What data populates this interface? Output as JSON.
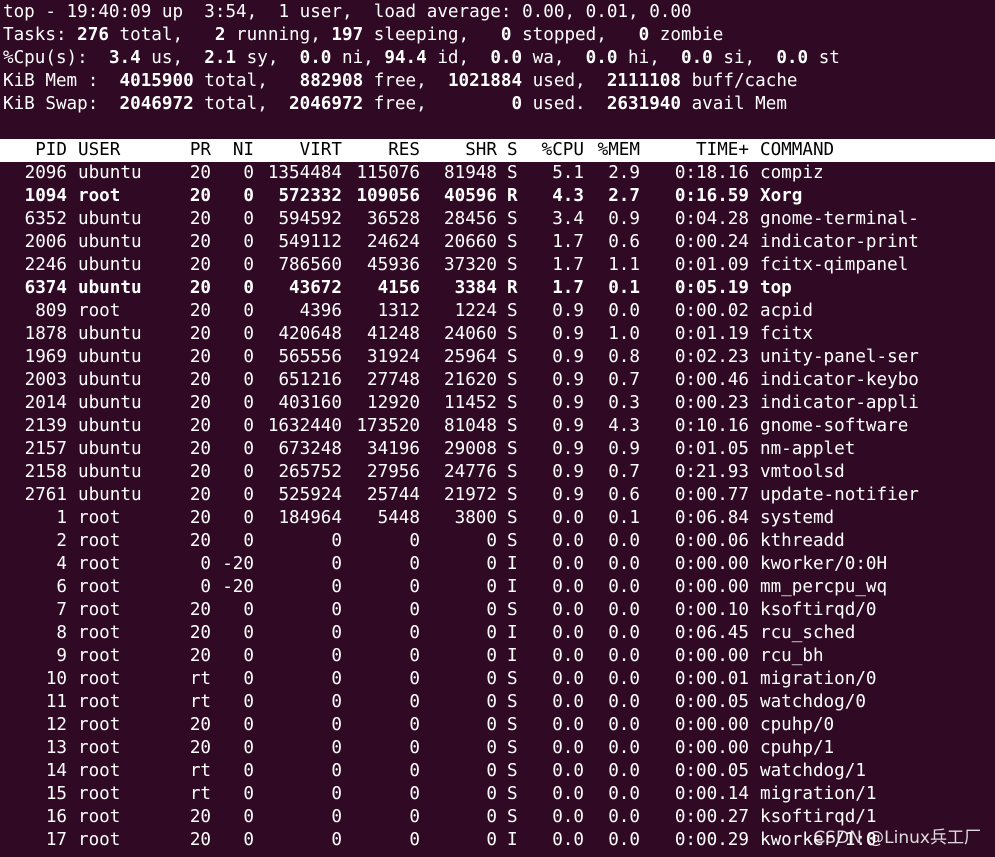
{
  "summary": {
    "uptime": {
      "time": "19:40:09",
      "up": "3:54",
      "users": "1",
      "load_avg": [
        "0.00",
        "0.01",
        "0.00"
      ]
    },
    "tasks": {
      "total": "276",
      "running": "2",
      "sleeping": "197",
      "stopped": "0",
      "zombie": "0"
    },
    "cpu": {
      "us": "3.4",
      "sy": "2.1",
      "ni": "0.0",
      "id": "94.4",
      "wa": "0.0",
      "hi": "0.0",
      "si": "0.0",
      "st": "0.0"
    },
    "mem": {
      "total": "4015900",
      "free": "882908",
      "used": "1021884",
      "buff_cache": "2111108"
    },
    "swap": {
      "total": "2046972",
      "free": "2046972",
      "used": "0",
      "avail_mem": "2631940"
    }
  },
  "columns": [
    "PID",
    "USER",
    "PR",
    "NI",
    "VIRT",
    "RES",
    "SHR",
    "S",
    "%CPU",
    "%MEM",
    "TIME+",
    "COMMAND"
  ],
  "processes": [
    {
      "pid": "2096",
      "user": "ubuntu",
      "pr": "20",
      "ni": "0",
      "virt": "1354484",
      "res": "115076",
      "shr": "81948",
      "s": "S",
      "cpu": "5.1",
      "mem": "2.9",
      "time": "0:18.16",
      "command": "compiz",
      "bold": false
    },
    {
      "pid": "1094",
      "user": "root",
      "pr": "20",
      "ni": "0",
      "virt": "572332",
      "res": "109056",
      "shr": "40596",
      "s": "R",
      "cpu": "4.3",
      "mem": "2.7",
      "time": "0:16.59",
      "command": "Xorg",
      "bold": true
    },
    {
      "pid": "6352",
      "user": "ubuntu",
      "pr": "20",
      "ni": "0",
      "virt": "594592",
      "res": "36528",
      "shr": "28456",
      "s": "S",
      "cpu": "3.4",
      "mem": "0.9",
      "time": "0:04.28",
      "command": "gnome-terminal-",
      "bold": false
    },
    {
      "pid": "2006",
      "user": "ubuntu",
      "pr": "20",
      "ni": "0",
      "virt": "549112",
      "res": "24624",
      "shr": "20660",
      "s": "S",
      "cpu": "1.7",
      "mem": "0.6",
      "time": "0:00.24",
      "command": "indicator-print",
      "bold": false
    },
    {
      "pid": "2246",
      "user": "ubuntu",
      "pr": "20",
      "ni": "0",
      "virt": "786560",
      "res": "45936",
      "shr": "37320",
      "s": "S",
      "cpu": "1.7",
      "mem": "1.1",
      "time": "0:01.09",
      "command": "fcitx-qimpanel",
      "bold": false
    },
    {
      "pid": "6374",
      "user": "ubuntu",
      "pr": "20",
      "ni": "0",
      "virt": "43672",
      "res": "4156",
      "shr": "3384",
      "s": "R",
      "cpu": "1.7",
      "mem": "0.1",
      "time": "0:05.19",
      "command": "top",
      "bold": true
    },
    {
      "pid": "809",
      "user": "root",
      "pr": "20",
      "ni": "0",
      "virt": "4396",
      "res": "1312",
      "shr": "1224",
      "s": "S",
      "cpu": "0.9",
      "mem": "0.0",
      "time": "0:00.02",
      "command": "acpid",
      "bold": false
    },
    {
      "pid": "1878",
      "user": "ubuntu",
      "pr": "20",
      "ni": "0",
      "virt": "420648",
      "res": "41248",
      "shr": "24060",
      "s": "S",
      "cpu": "0.9",
      "mem": "1.0",
      "time": "0:01.19",
      "command": "fcitx",
      "bold": false
    },
    {
      "pid": "1969",
      "user": "ubuntu",
      "pr": "20",
      "ni": "0",
      "virt": "565556",
      "res": "31924",
      "shr": "25964",
      "s": "S",
      "cpu": "0.9",
      "mem": "0.8",
      "time": "0:02.23",
      "command": "unity-panel-ser",
      "bold": false
    },
    {
      "pid": "2003",
      "user": "ubuntu",
      "pr": "20",
      "ni": "0",
      "virt": "651216",
      "res": "27748",
      "shr": "21620",
      "s": "S",
      "cpu": "0.9",
      "mem": "0.7",
      "time": "0:00.46",
      "command": "indicator-keybo",
      "bold": false
    },
    {
      "pid": "2014",
      "user": "ubuntu",
      "pr": "20",
      "ni": "0",
      "virt": "403160",
      "res": "12920",
      "shr": "11452",
      "s": "S",
      "cpu": "0.9",
      "mem": "0.3",
      "time": "0:00.23",
      "command": "indicator-appli",
      "bold": false
    },
    {
      "pid": "2139",
      "user": "ubuntu",
      "pr": "20",
      "ni": "0",
      "virt": "1632440",
      "res": "173520",
      "shr": "81048",
      "s": "S",
      "cpu": "0.9",
      "mem": "4.3",
      "time": "0:10.16",
      "command": "gnome-software",
      "bold": false
    },
    {
      "pid": "2157",
      "user": "ubuntu",
      "pr": "20",
      "ni": "0",
      "virt": "673248",
      "res": "34196",
      "shr": "29008",
      "s": "S",
      "cpu": "0.9",
      "mem": "0.9",
      "time": "0:01.05",
      "command": "nm-applet",
      "bold": false
    },
    {
      "pid": "2158",
      "user": "ubuntu",
      "pr": "20",
      "ni": "0",
      "virt": "265752",
      "res": "27956",
      "shr": "24776",
      "s": "S",
      "cpu": "0.9",
      "mem": "0.7",
      "time": "0:21.93",
      "command": "vmtoolsd",
      "bold": false
    },
    {
      "pid": "2761",
      "user": "ubuntu",
      "pr": "20",
      "ni": "0",
      "virt": "525924",
      "res": "25744",
      "shr": "21972",
      "s": "S",
      "cpu": "0.9",
      "mem": "0.6",
      "time": "0:00.77",
      "command": "update-notifier",
      "bold": false
    },
    {
      "pid": "1",
      "user": "root",
      "pr": "20",
      "ni": "0",
      "virt": "184964",
      "res": "5448",
      "shr": "3800",
      "s": "S",
      "cpu": "0.0",
      "mem": "0.1",
      "time": "0:06.84",
      "command": "systemd",
      "bold": false
    },
    {
      "pid": "2",
      "user": "root",
      "pr": "20",
      "ni": "0",
      "virt": "0",
      "res": "0",
      "shr": "0",
      "s": "S",
      "cpu": "0.0",
      "mem": "0.0",
      "time": "0:00.06",
      "command": "kthreadd",
      "bold": false
    },
    {
      "pid": "4",
      "user": "root",
      "pr": "0",
      "ni": "-20",
      "virt": "0",
      "res": "0",
      "shr": "0",
      "s": "I",
      "cpu": "0.0",
      "mem": "0.0",
      "time": "0:00.00",
      "command": "kworker/0:0H",
      "bold": false
    },
    {
      "pid": "6",
      "user": "root",
      "pr": "0",
      "ni": "-20",
      "virt": "0",
      "res": "0",
      "shr": "0",
      "s": "I",
      "cpu": "0.0",
      "mem": "0.0",
      "time": "0:00.00",
      "command": "mm_percpu_wq",
      "bold": false
    },
    {
      "pid": "7",
      "user": "root",
      "pr": "20",
      "ni": "0",
      "virt": "0",
      "res": "0",
      "shr": "0",
      "s": "S",
      "cpu": "0.0",
      "mem": "0.0",
      "time": "0:00.10",
      "command": "ksoftirqd/0",
      "bold": false
    },
    {
      "pid": "8",
      "user": "root",
      "pr": "20",
      "ni": "0",
      "virt": "0",
      "res": "0",
      "shr": "0",
      "s": "I",
      "cpu": "0.0",
      "mem": "0.0",
      "time": "0:06.45",
      "command": "rcu_sched",
      "bold": false
    },
    {
      "pid": "9",
      "user": "root",
      "pr": "20",
      "ni": "0",
      "virt": "0",
      "res": "0",
      "shr": "0",
      "s": "I",
      "cpu": "0.0",
      "mem": "0.0",
      "time": "0:00.00",
      "command": "rcu_bh",
      "bold": false
    },
    {
      "pid": "10",
      "user": "root",
      "pr": "rt",
      "ni": "0",
      "virt": "0",
      "res": "0",
      "shr": "0",
      "s": "S",
      "cpu": "0.0",
      "mem": "0.0",
      "time": "0:00.01",
      "command": "migration/0",
      "bold": false
    },
    {
      "pid": "11",
      "user": "root",
      "pr": "rt",
      "ni": "0",
      "virt": "0",
      "res": "0",
      "shr": "0",
      "s": "S",
      "cpu": "0.0",
      "mem": "0.0",
      "time": "0:00.05",
      "command": "watchdog/0",
      "bold": false
    },
    {
      "pid": "12",
      "user": "root",
      "pr": "20",
      "ni": "0",
      "virt": "0",
      "res": "0",
      "shr": "0",
      "s": "S",
      "cpu": "0.0",
      "mem": "0.0",
      "time": "0:00.00",
      "command": "cpuhp/0",
      "bold": false
    },
    {
      "pid": "13",
      "user": "root",
      "pr": "20",
      "ni": "0",
      "virt": "0",
      "res": "0",
      "shr": "0",
      "s": "S",
      "cpu": "0.0",
      "mem": "0.0",
      "time": "0:00.00",
      "command": "cpuhp/1",
      "bold": false
    },
    {
      "pid": "14",
      "user": "root",
      "pr": "rt",
      "ni": "0",
      "virt": "0",
      "res": "0",
      "shr": "0",
      "s": "S",
      "cpu": "0.0",
      "mem": "0.0",
      "time": "0:00.05",
      "command": "watchdog/1",
      "bold": false
    },
    {
      "pid": "15",
      "user": "root",
      "pr": "rt",
      "ni": "0",
      "virt": "0",
      "res": "0",
      "shr": "0",
      "s": "S",
      "cpu": "0.0",
      "mem": "0.0",
      "time": "0:00.14",
      "command": "migration/1",
      "bold": false
    },
    {
      "pid": "16",
      "user": "root",
      "pr": "20",
      "ni": "0",
      "virt": "0",
      "res": "0",
      "shr": "0",
      "s": "S",
      "cpu": "0.0",
      "mem": "0.0",
      "time": "0:00.27",
      "command": "ksoftirqd/1",
      "bold": false
    },
    {
      "pid": "17",
      "user": "root",
      "pr": "20",
      "ni": "0",
      "virt": "0",
      "res": "0",
      "shr": "0",
      "s": "I",
      "cpu": "0.0",
      "mem": "0.0",
      "time": "0:00.29",
      "command": "kworker/1:0",
      "bold": false
    }
  ],
  "watermark": "CSDN @Linux兵工厂",
  "colors": {
    "background": "#300a24",
    "text": "#ffffff",
    "header_bg": "#ffffff",
    "header_text": "#000000"
  }
}
